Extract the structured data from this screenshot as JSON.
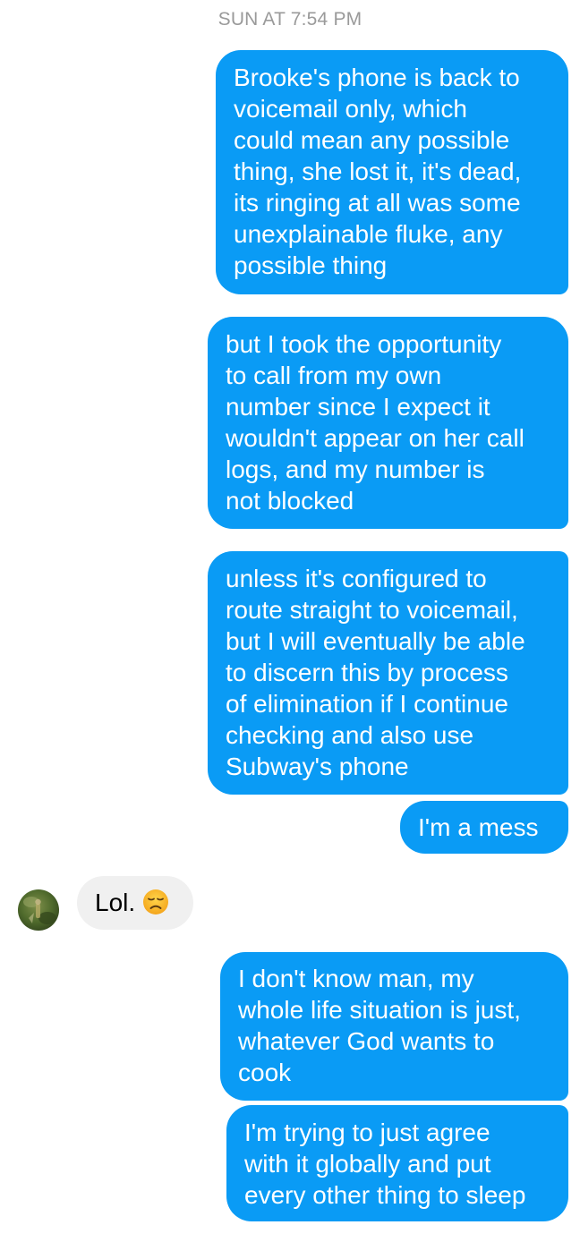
{
  "conversation": {
    "timestamp": "SUN AT 7:54 PM",
    "messages": [
      {
        "direction": "outgoing",
        "text": "Brooke's phone is back to\nvoicemail only, which\ncould mean any possible\nthing, she lost it, it's dead,\nits ringing at all was some\nunexplainable fluke, any\npossible thing"
      },
      {
        "direction": "outgoing",
        "text": "but I took the opportunity\nto call from my own\nnumber since I expect it\nwouldn't appear on her call\nlogs, and my number is\nnot blocked"
      },
      {
        "direction": "outgoing",
        "text": "unless it's configured to\nroute straight to voicemail,\nbut I will eventually be able\nto discern this by process\nof elimination if I continue\nchecking and also use\nSubway's phone"
      },
      {
        "direction": "outgoing",
        "text": "I'm a mess"
      },
      {
        "direction": "incoming",
        "text": "Lol.",
        "emoji": "disappointed-face-emoji"
      },
      {
        "direction": "outgoing",
        "text": "I don't know man, my\nwhole life situation is just,\nwhatever God wants to\ncook"
      },
      {
        "direction": "outgoing",
        "text": "I'm trying to just agree\nwith it globally and put\nevery other thing to sleep"
      }
    ]
  },
  "colors": {
    "outgoing_bubble": "#0a9bf5",
    "incoming_bubble": "#f0f0f0",
    "timestamp_text": "#9a9a9a"
  }
}
